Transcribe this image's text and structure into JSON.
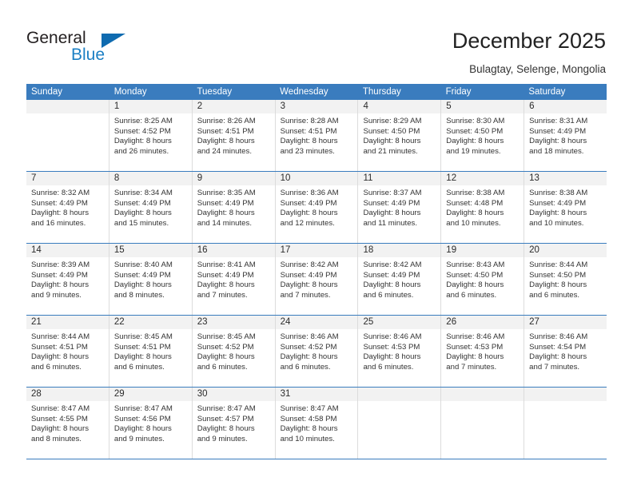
{
  "brand": {
    "name_part1": "General",
    "name_part2": "Blue",
    "accent_color": "#1b7fc4",
    "triangle_color": "#0f6bb0"
  },
  "header": {
    "title": "December 2025",
    "location": "Bulagtay, Selenge, Mongolia"
  },
  "calendar": {
    "header_bg": "#3a7cbe",
    "daynum_bg": "#f2f2f2",
    "weekdays": [
      "Sunday",
      "Monday",
      "Tuesday",
      "Wednesday",
      "Thursday",
      "Friday",
      "Saturday"
    ],
    "weeks": [
      [
        {
          "day": "",
          "lines": []
        },
        {
          "day": "1",
          "lines": [
            "Sunrise: 8:25 AM",
            "Sunset: 4:52 PM",
            "Daylight: 8 hours",
            "and 26 minutes."
          ]
        },
        {
          "day": "2",
          "lines": [
            "Sunrise: 8:26 AM",
            "Sunset: 4:51 PM",
            "Daylight: 8 hours",
            "and 24 minutes."
          ]
        },
        {
          "day": "3",
          "lines": [
            "Sunrise: 8:28 AM",
            "Sunset: 4:51 PM",
            "Daylight: 8 hours",
            "and 23 minutes."
          ]
        },
        {
          "day": "4",
          "lines": [
            "Sunrise: 8:29 AM",
            "Sunset: 4:50 PM",
            "Daylight: 8 hours",
            "and 21 minutes."
          ]
        },
        {
          "day": "5",
          "lines": [
            "Sunrise: 8:30 AM",
            "Sunset: 4:50 PM",
            "Daylight: 8 hours",
            "and 19 minutes."
          ]
        },
        {
          "day": "6",
          "lines": [
            "Sunrise: 8:31 AM",
            "Sunset: 4:49 PM",
            "Daylight: 8 hours",
            "and 18 minutes."
          ]
        }
      ],
      [
        {
          "day": "7",
          "lines": [
            "Sunrise: 8:32 AM",
            "Sunset: 4:49 PM",
            "Daylight: 8 hours",
            "and 16 minutes."
          ]
        },
        {
          "day": "8",
          "lines": [
            "Sunrise: 8:34 AM",
            "Sunset: 4:49 PM",
            "Daylight: 8 hours",
            "and 15 minutes."
          ]
        },
        {
          "day": "9",
          "lines": [
            "Sunrise: 8:35 AM",
            "Sunset: 4:49 PM",
            "Daylight: 8 hours",
            "and 14 minutes."
          ]
        },
        {
          "day": "10",
          "lines": [
            "Sunrise: 8:36 AM",
            "Sunset: 4:49 PM",
            "Daylight: 8 hours",
            "and 12 minutes."
          ]
        },
        {
          "day": "11",
          "lines": [
            "Sunrise: 8:37 AM",
            "Sunset: 4:49 PM",
            "Daylight: 8 hours",
            "and 11 minutes."
          ]
        },
        {
          "day": "12",
          "lines": [
            "Sunrise: 8:38 AM",
            "Sunset: 4:48 PM",
            "Daylight: 8 hours",
            "and 10 minutes."
          ]
        },
        {
          "day": "13",
          "lines": [
            "Sunrise: 8:38 AM",
            "Sunset: 4:49 PM",
            "Daylight: 8 hours",
            "and 10 minutes."
          ]
        }
      ],
      [
        {
          "day": "14",
          "lines": [
            "Sunrise: 8:39 AM",
            "Sunset: 4:49 PM",
            "Daylight: 8 hours",
            "and 9 minutes."
          ]
        },
        {
          "day": "15",
          "lines": [
            "Sunrise: 8:40 AM",
            "Sunset: 4:49 PM",
            "Daylight: 8 hours",
            "and 8 minutes."
          ]
        },
        {
          "day": "16",
          "lines": [
            "Sunrise: 8:41 AM",
            "Sunset: 4:49 PM",
            "Daylight: 8 hours",
            "and 7 minutes."
          ]
        },
        {
          "day": "17",
          "lines": [
            "Sunrise: 8:42 AM",
            "Sunset: 4:49 PM",
            "Daylight: 8 hours",
            "and 7 minutes."
          ]
        },
        {
          "day": "18",
          "lines": [
            "Sunrise: 8:42 AM",
            "Sunset: 4:49 PM",
            "Daylight: 8 hours",
            "and 6 minutes."
          ]
        },
        {
          "day": "19",
          "lines": [
            "Sunrise: 8:43 AM",
            "Sunset: 4:50 PM",
            "Daylight: 8 hours",
            "and 6 minutes."
          ]
        },
        {
          "day": "20",
          "lines": [
            "Sunrise: 8:44 AM",
            "Sunset: 4:50 PM",
            "Daylight: 8 hours",
            "and 6 minutes."
          ]
        }
      ],
      [
        {
          "day": "21",
          "lines": [
            "Sunrise: 8:44 AM",
            "Sunset: 4:51 PM",
            "Daylight: 8 hours",
            "and 6 minutes."
          ]
        },
        {
          "day": "22",
          "lines": [
            "Sunrise: 8:45 AM",
            "Sunset: 4:51 PM",
            "Daylight: 8 hours",
            "and 6 minutes."
          ]
        },
        {
          "day": "23",
          "lines": [
            "Sunrise: 8:45 AM",
            "Sunset: 4:52 PM",
            "Daylight: 8 hours",
            "and 6 minutes."
          ]
        },
        {
          "day": "24",
          "lines": [
            "Sunrise: 8:46 AM",
            "Sunset: 4:52 PM",
            "Daylight: 8 hours",
            "and 6 minutes."
          ]
        },
        {
          "day": "25",
          "lines": [
            "Sunrise: 8:46 AM",
            "Sunset: 4:53 PM",
            "Daylight: 8 hours",
            "and 6 minutes."
          ]
        },
        {
          "day": "26",
          "lines": [
            "Sunrise: 8:46 AM",
            "Sunset: 4:53 PM",
            "Daylight: 8 hours",
            "and 7 minutes."
          ]
        },
        {
          "day": "27",
          "lines": [
            "Sunrise: 8:46 AM",
            "Sunset: 4:54 PM",
            "Daylight: 8 hours",
            "and 7 minutes."
          ]
        }
      ],
      [
        {
          "day": "28",
          "lines": [
            "Sunrise: 8:47 AM",
            "Sunset: 4:55 PM",
            "Daylight: 8 hours",
            "and 8 minutes."
          ]
        },
        {
          "day": "29",
          "lines": [
            "Sunrise: 8:47 AM",
            "Sunset: 4:56 PM",
            "Daylight: 8 hours",
            "and 9 minutes."
          ]
        },
        {
          "day": "30",
          "lines": [
            "Sunrise: 8:47 AM",
            "Sunset: 4:57 PM",
            "Daylight: 8 hours",
            "and 9 minutes."
          ]
        },
        {
          "day": "31",
          "lines": [
            "Sunrise: 8:47 AM",
            "Sunset: 4:58 PM",
            "Daylight: 8 hours",
            "and 10 minutes."
          ]
        },
        {
          "day": "",
          "lines": []
        },
        {
          "day": "",
          "lines": []
        },
        {
          "day": "",
          "lines": []
        }
      ]
    ]
  }
}
